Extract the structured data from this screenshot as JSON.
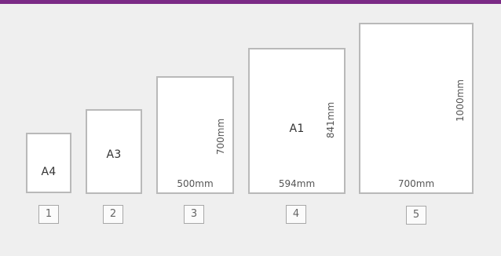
{
  "colors": {
    "accent_bar": "#7b2a86",
    "background": "#efefef",
    "sheet_border": "#b9b9b9"
  },
  "sheets": [
    {
      "index": "1",
      "label": "A4",
      "width_label": "",
      "height_label": ""
    },
    {
      "index": "2",
      "label": "A3",
      "width_label": "",
      "height_label": ""
    },
    {
      "index": "3",
      "label": "",
      "width_label": "500mm",
      "height_label": "700mm"
    },
    {
      "index": "4",
      "label": "A1",
      "width_label": "594mm",
      "height_label": "841mm"
    },
    {
      "index": "5",
      "label": "",
      "width_label": "700mm",
      "height_label": "1000mm"
    }
  ]
}
